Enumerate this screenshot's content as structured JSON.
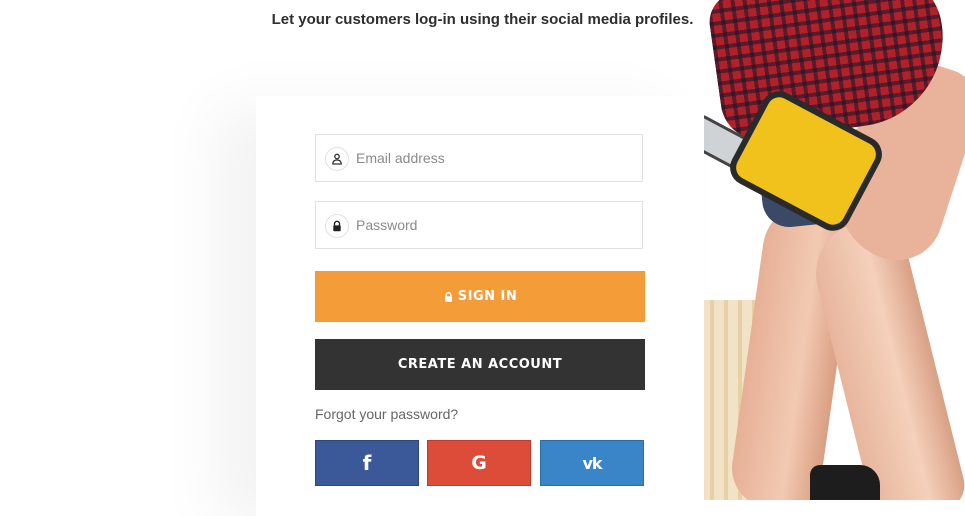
{
  "headline": "Let your customers log-in using their social media profiles.",
  "login_form": {
    "email": {
      "placeholder": "Email address",
      "value": "",
      "icon": "user-icon"
    },
    "password": {
      "placeholder": "Password",
      "value": "",
      "icon": "lock-icon"
    },
    "sign_in_label": "SIGN IN",
    "create_account_label": "CREATE AN ACCOUNT",
    "forgot_password_label": "Forgot your password?"
  },
  "social_buttons": [
    {
      "network": "facebook",
      "glyph": "f",
      "icon": "facebook-icon",
      "color": "#3b5998"
    },
    {
      "network": "google",
      "glyph": "G",
      "icon": "google-icon",
      "color": "#dd4b39"
    },
    {
      "network": "vk",
      "glyph": "vk",
      "icon": "vk-icon",
      "color": "#3a85c8"
    }
  ],
  "colors": {
    "accent": "#f39c38",
    "dark_button": "#333333"
  }
}
